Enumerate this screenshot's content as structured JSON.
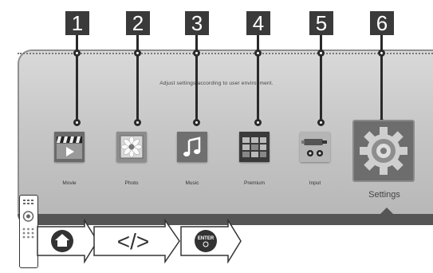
{
  "callouts": [
    "1",
    "2",
    "3",
    "4",
    "5",
    "6"
  ],
  "screen": {
    "description": "Adjust settings according to user environment."
  },
  "menu": [
    {
      "label": "Movie",
      "icon": "movie-icon"
    },
    {
      "label": "Photo",
      "icon": "photo-icon"
    },
    {
      "label": "Music",
      "icon": "music-icon"
    },
    {
      "label": "Premium",
      "icon": "premium-icon"
    },
    {
      "label": "Input",
      "icon": "input-icon"
    },
    {
      "label": "Settings",
      "icon": "settings-gear-icon",
      "selected": true
    }
  ],
  "key_sequence": [
    {
      "name": "home-key",
      "glyph": "home-icon"
    },
    {
      "name": "arrow-keys",
      "text": "</>"
    },
    {
      "name": "enter-key",
      "text": "ENTER"
    }
  ],
  "colors": {
    "callout_bg": "#3a3a3a",
    "screen_bg": "#c7c7c7",
    "band": "#555555"
  }
}
